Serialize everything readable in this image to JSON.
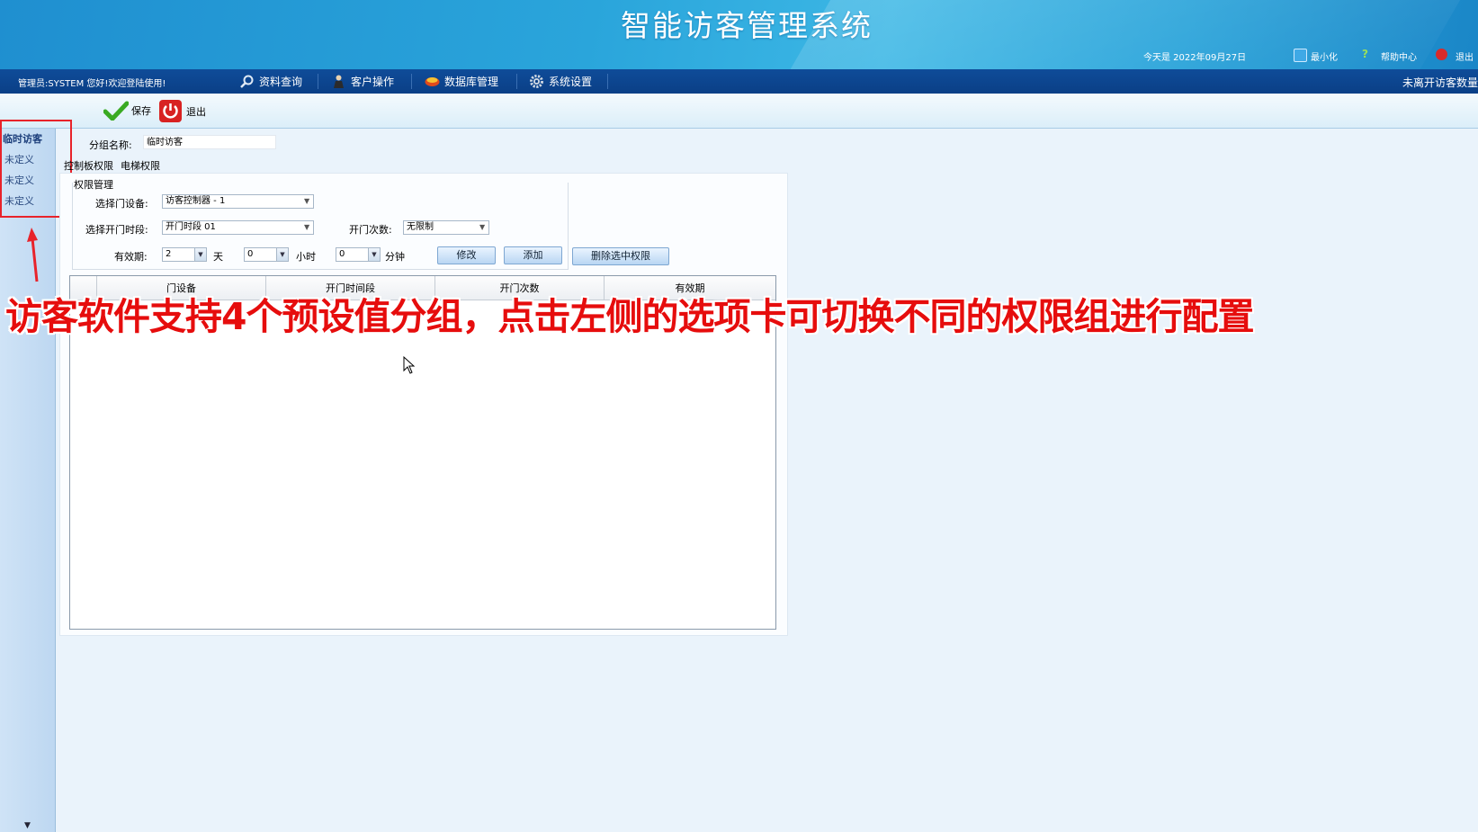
{
  "header": {
    "title": "智能访客管理系统",
    "date_text": "今天是 2022年09月27日",
    "minimize_label": "最小化",
    "help_label": "帮助中心",
    "exit_label": "退出"
  },
  "navbar": {
    "admin_text": "管理员:SYSTEM 您好!欢迎登陆使用!",
    "items": [
      {
        "label": "资料查询",
        "icon": "search-icon"
      },
      {
        "label": "客户操作",
        "icon": "user-icon"
      },
      {
        "label": "数据库管理",
        "icon": "database-icon"
      },
      {
        "label": "系统设置",
        "icon": "gear-icon"
      }
    ],
    "right_text": "未离开访客数量"
  },
  "toolbar": {
    "save_label": "保存",
    "exit_label": "退出"
  },
  "sidebar": {
    "items": [
      {
        "label": "临时访客",
        "active": true
      },
      {
        "label": "未定义",
        "active": false
      },
      {
        "label": "未定义",
        "active": false
      },
      {
        "label": "未定义",
        "active": false
      }
    ]
  },
  "form": {
    "group_name_label": "分组名称:",
    "group_name_value": "临时访客",
    "tabs": [
      "控制板权限",
      "电梯权限"
    ],
    "section_title": "权限管理",
    "door_device_label": "选择门设备:",
    "door_device_value": "访客控制器 - 1",
    "time_slot_label": "选择开门时段:",
    "time_slot_value": "开门时段 01",
    "open_count_label": "开门次数:",
    "open_count_value": "无限制",
    "validity_label": "有效期:",
    "days_value": "2",
    "days_unit": "天",
    "hours_value": "0",
    "hours_unit": "小时",
    "minutes_value": "0",
    "minutes_unit": "分钟",
    "modify_button": "修改",
    "add_button": "添加",
    "delete_button": "删除选中权限"
  },
  "table": {
    "columns": [
      "门设备",
      "开门时间段",
      "开门次数",
      "有效期"
    ],
    "rows": []
  },
  "overlay": {
    "caption": "访客软件支持4个预设值分组，点击左侧的选项卡可切换不同的权限组进行配置"
  },
  "colors": {
    "header_blue": "#2aa5db",
    "nav_blue": "#0f4c99",
    "annotation_red": "#e60d0d"
  }
}
